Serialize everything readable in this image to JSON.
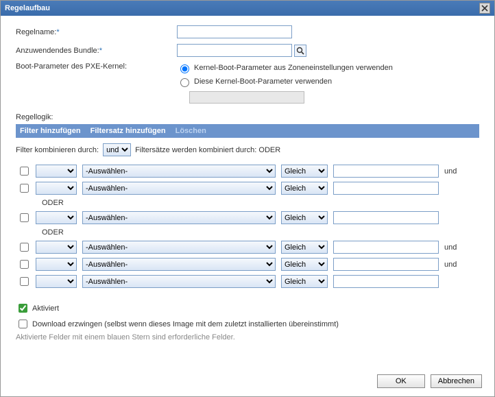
{
  "title": "Regelaufbau",
  "fields": {
    "ruleName": {
      "label": "Regelname:",
      "value": ""
    },
    "bundle": {
      "label": "Anzuwendendes Bundle:",
      "value": ""
    },
    "bootParam": {
      "label": "Boot-Parameter des PXE-Kernel:"
    }
  },
  "radios": {
    "opt1": "Kernel-Boot-Parameter aus Zoneneinstellungen verwenden",
    "opt2": "Diese Kernel-Boot-Parameter verwenden",
    "sub_value": ""
  },
  "logic": {
    "heading": "Regellogik:",
    "addFilter": "Filter hinzufügen",
    "addFilterSet": "Filtersatz hinzufügen",
    "delete": "Löschen",
    "combineLabel": "Filter kombinieren durch:",
    "combineValue": "und",
    "setsLabel": "Filtersätze werden kombiniert durch: ODER"
  },
  "filterPlaceholders": {
    "select": "-Auswählen-",
    "op": "Gleich",
    "and": "und",
    "or": "ODER"
  },
  "filters": [
    {
      "trailing": "und"
    },
    {
      "trailing": ""
    },
    {
      "trailing": ""
    },
    {
      "trailing": "und"
    },
    {
      "trailing": "und"
    },
    {
      "trailing": ""
    }
  ],
  "checks": {
    "enabled": "Aktiviert",
    "force": "Download erzwingen (selbst wenn dieses Image mit dem zuletzt installierten übereinstimmt)",
    "note": "Aktivierte Felder mit einem blauen Stern sind erforderliche Felder."
  },
  "buttons": {
    "ok": "OK",
    "cancel": "Abbrechen"
  }
}
